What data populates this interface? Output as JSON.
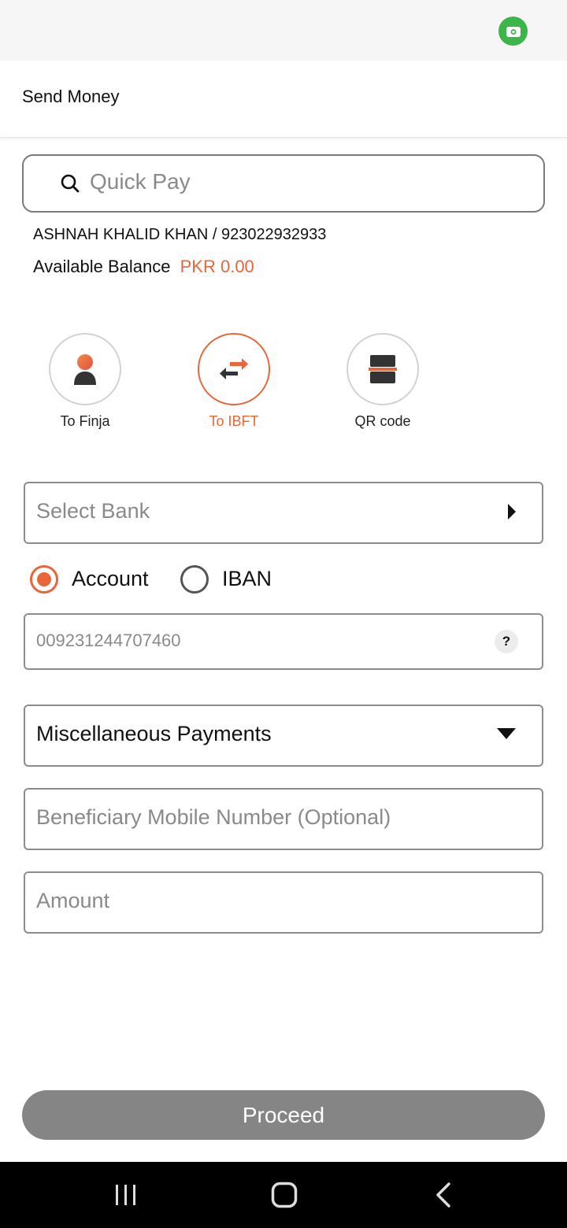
{
  "header": {
    "title": "Send Money"
  },
  "search": {
    "placeholder": "Quick Pay"
  },
  "account": {
    "user_line": "ASHNAH KHALID KHAN / 923022932933",
    "balance_label": "Available Balance",
    "balance_value": "PKR 0.00"
  },
  "options": [
    {
      "label": "To Finja",
      "icon": "person-icon",
      "active": false
    },
    {
      "label": "To IBFT",
      "icon": "transfer-arrows-icon",
      "active": true
    },
    {
      "label": "QR code",
      "icon": "qr-code-icon",
      "active": false
    }
  ],
  "form": {
    "bank_placeholder": "Select Bank",
    "radio_options": [
      "Account",
      "IBAN"
    ],
    "selected_radio": "Account",
    "account_number_placeholder": "009231244707460",
    "help_symbol": "?",
    "purpose_value": "Miscellaneous Payments",
    "mobile_placeholder": "Beneficiary Mobile Number (Optional)",
    "amount_placeholder": "Amount"
  },
  "actions": {
    "proceed_label": "Proceed"
  },
  "colors": {
    "accent": "#e8663a",
    "button_disabled": "#858585",
    "status_badge": "#3cb54a"
  }
}
